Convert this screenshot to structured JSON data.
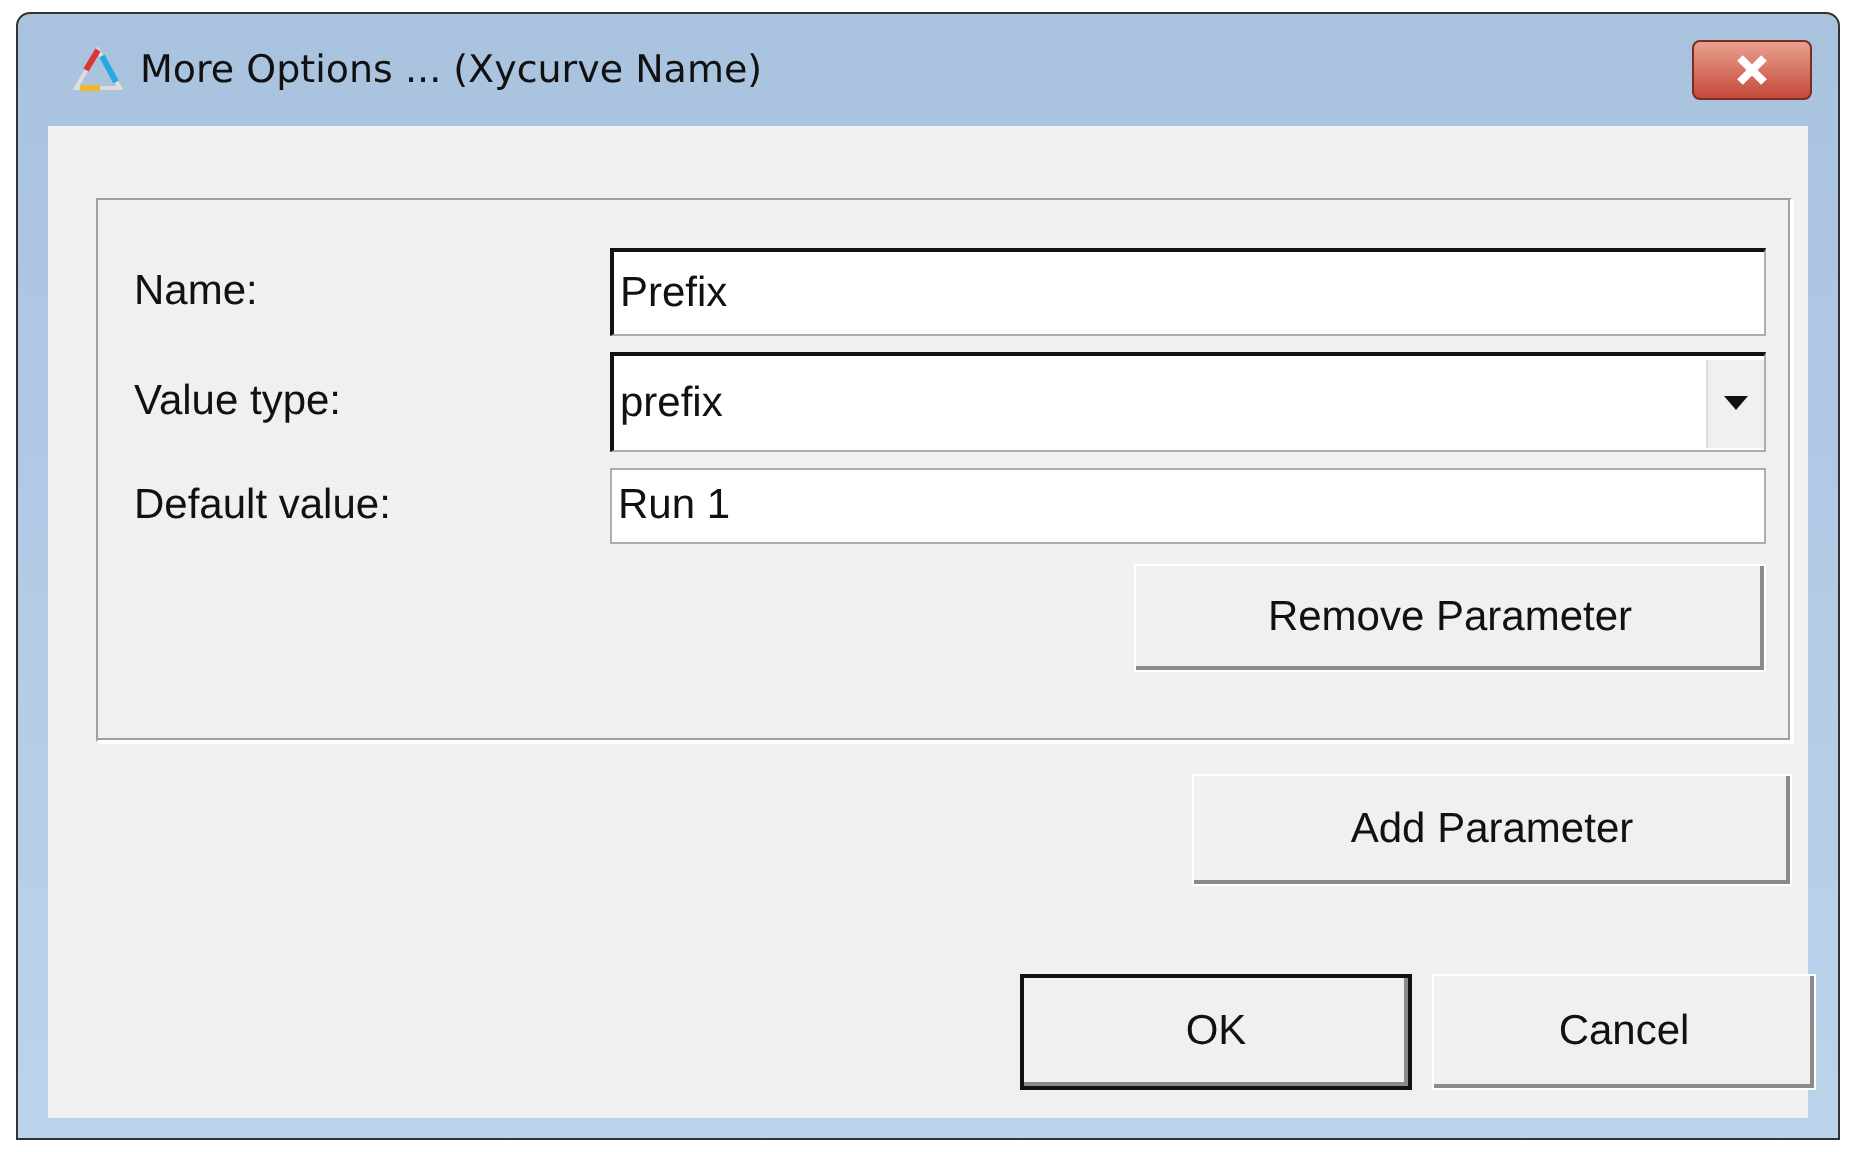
{
  "window": {
    "title": "More Options ... (Xycurve Name)"
  },
  "fields": [
    {
      "kind": "text",
      "label": "Name:",
      "value": "Prefix",
      "focused": true
    },
    {
      "kind": "dropdown",
      "label": "Value type:",
      "value": "prefix",
      "focused": true
    },
    {
      "kind": "text",
      "label": "Default value:",
      "value": "Run 1",
      "focused": false
    }
  ],
  "group_button": "Remove Parameter",
  "add_button": "Add Parameter",
  "buttons": [
    {
      "label": "OK",
      "default": true
    },
    {
      "label": "Cancel",
      "default": false
    }
  ]
}
